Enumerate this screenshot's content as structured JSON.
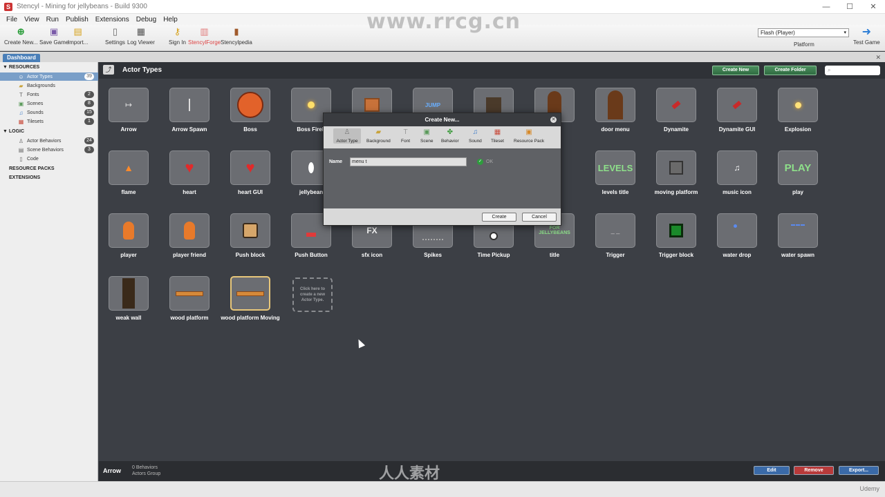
{
  "window": {
    "title": "Stencyl - Mining for jellybeans - Build 9300"
  },
  "menu": [
    "File",
    "View",
    "Run",
    "Publish",
    "Extensions",
    "Debug",
    "Help"
  ],
  "toolbar": {
    "buttons": [
      {
        "label": "Create New...",
        "icon": "plus-icon"
      },
      {
        "label": "Save Game",
        "icon": "save-icon"
      },
      {
        "label": "Import...",
        "icon": "import-icon"
      },
      {
        "label": "Settings",
        "icon": "settings-icon"
      },
      {
        "label": "Log Viewer",
        "icon": "log-icon"
      },
      {
        "label": "Sign In",
        "icon": "key-icon"
      },
      {
        "label": "StencylForge",
        "icon": "forge-icon"
      },
      {
        "label": "Stencylpedia",
        "icon": "book-icon"
      },
      {
        "label": "Test Game",
        "icon": "arrow-right-icon"
      }
    ],
    "platform_value": "Flash (Player)",
    "platform_label": "Platform"
  },
  "tabs": {
    "dashboard": "Dashboard"
  },
  "sidebar": {
    "resources_heading": "RESOURCES",
    "resources": [
      {
        "label": "Actor Types",
        "count": "39",
        "icon": "actor-icon",
        "selected": true
      },
      {
        "label": "Backgrounds",
        "count": "",
        "icon": "background-icon"
      },
      {
        "label": "Fonts",
        "count": "2",
        "icon": "font-icon"
      },
      {
        "label": "Scenes",
        "count": "8",
        "icon": "scene-icon"
      },
      {
        "label": "Sounds",
        "count": "15",
        "icon": "sound-icon"
      },
      {
        "label": "Tilesets",
        "count": "1",
        "icon": "tileset-icon"
      }
    ],
    "logic_heading": "LOGIC",
    "logic": [
      {
        "label": "Actor Behaviors",
        "count": "24",
        "icon": "behavior-icon"
      },
      {
        "label": "Scene Behaviors",
        "count": "3",
        "icon": "behavior-icon"
      },
      {
        "label": "Code",
        "count": "",
        "icon": "code-icon"
      }
    ],
    "resource_packs": "RESOURCE PACKS",
    "extensions": "EXTENSIONS"
  },
  "main": {
    "title": "Actor Types",
    "create_new": "Create New",
    "create_folder": "Create Folder",
    "search_placeholder": "",
    "tiles": [
      "Arrow",
      "Arrow Spawn",
      "Boss",
      "Boss Fireb",
      "",
      "",
      "",
      "",
      "door menu",
      "Dynamite",
      "Dynamite GUI",
      "Explosion",
      "flame",
      "heart",
      "heart GUI",
      "jellybean",
      "",
      "",
      "",
      "r",
      "levels title",
      "moving platform",
      "music icon",
      "play",
      "player",
      "player friend",
      "Push block",
      "Push Button",
      "sfx icon",
      "Spikes",
      "Time Pickup",
      "title",
      "Trigger",
      "Trigger block",
      "water drop",
      "water spawn",
      "weak wall",
      "wood platform",
      "wood platform Moving"
    ],
    "tile_text": {
      "jump": "JUMP",
      "levels": "LEVELS",
      "play": "PLAY",
      "fx": "FX",
      "title_art": "FOR JELLYBEANS"
    },
    "new_tile_text": "Click here to create a new Actor Type."
  },
  "dialog": {
    "title": "Create New...",
    "tools": [
      {
        "label": "Actor Type",
        "icon": "actor-icon"
      },
      {
        "label": "Background",
        "icon": "background-icon"
      },
      {
        "label": "Font",
        "icon": "font-icon"
      },
      {
        "label": "Scene",
        "icon": "scene-icon"
      },
      {
        "label": "Behavior",
        "icon": "behavior-icon"
      },
      {
        "label": "Sound",
        "icon": "sound-icon"
      },
      {
        "label": "Tileset",
        "icon": "tileset-icon"
      },
      {
        "label": "Resource Pack",
        "icon": "pack-icon"
      }
    ],
    "name_label": "Name",
    "name_value": "menu t",
    "ok_text": "OK",
    "create": "Create",
    "cancel": "Cancel"
  },
  "bottom": {
    "selected_name": "Arrow",
    "behaviors": "0 Behaviors",
    "group": "Actors Group",
    "edit": "Edit",
    "remove": "Remove",
    "export": "Export..."
  },
  "watermark": {
    "url": "www.rrcg.cn",
    "logo": "人人素材",
    "udemy": "Udemy"
  }
}
